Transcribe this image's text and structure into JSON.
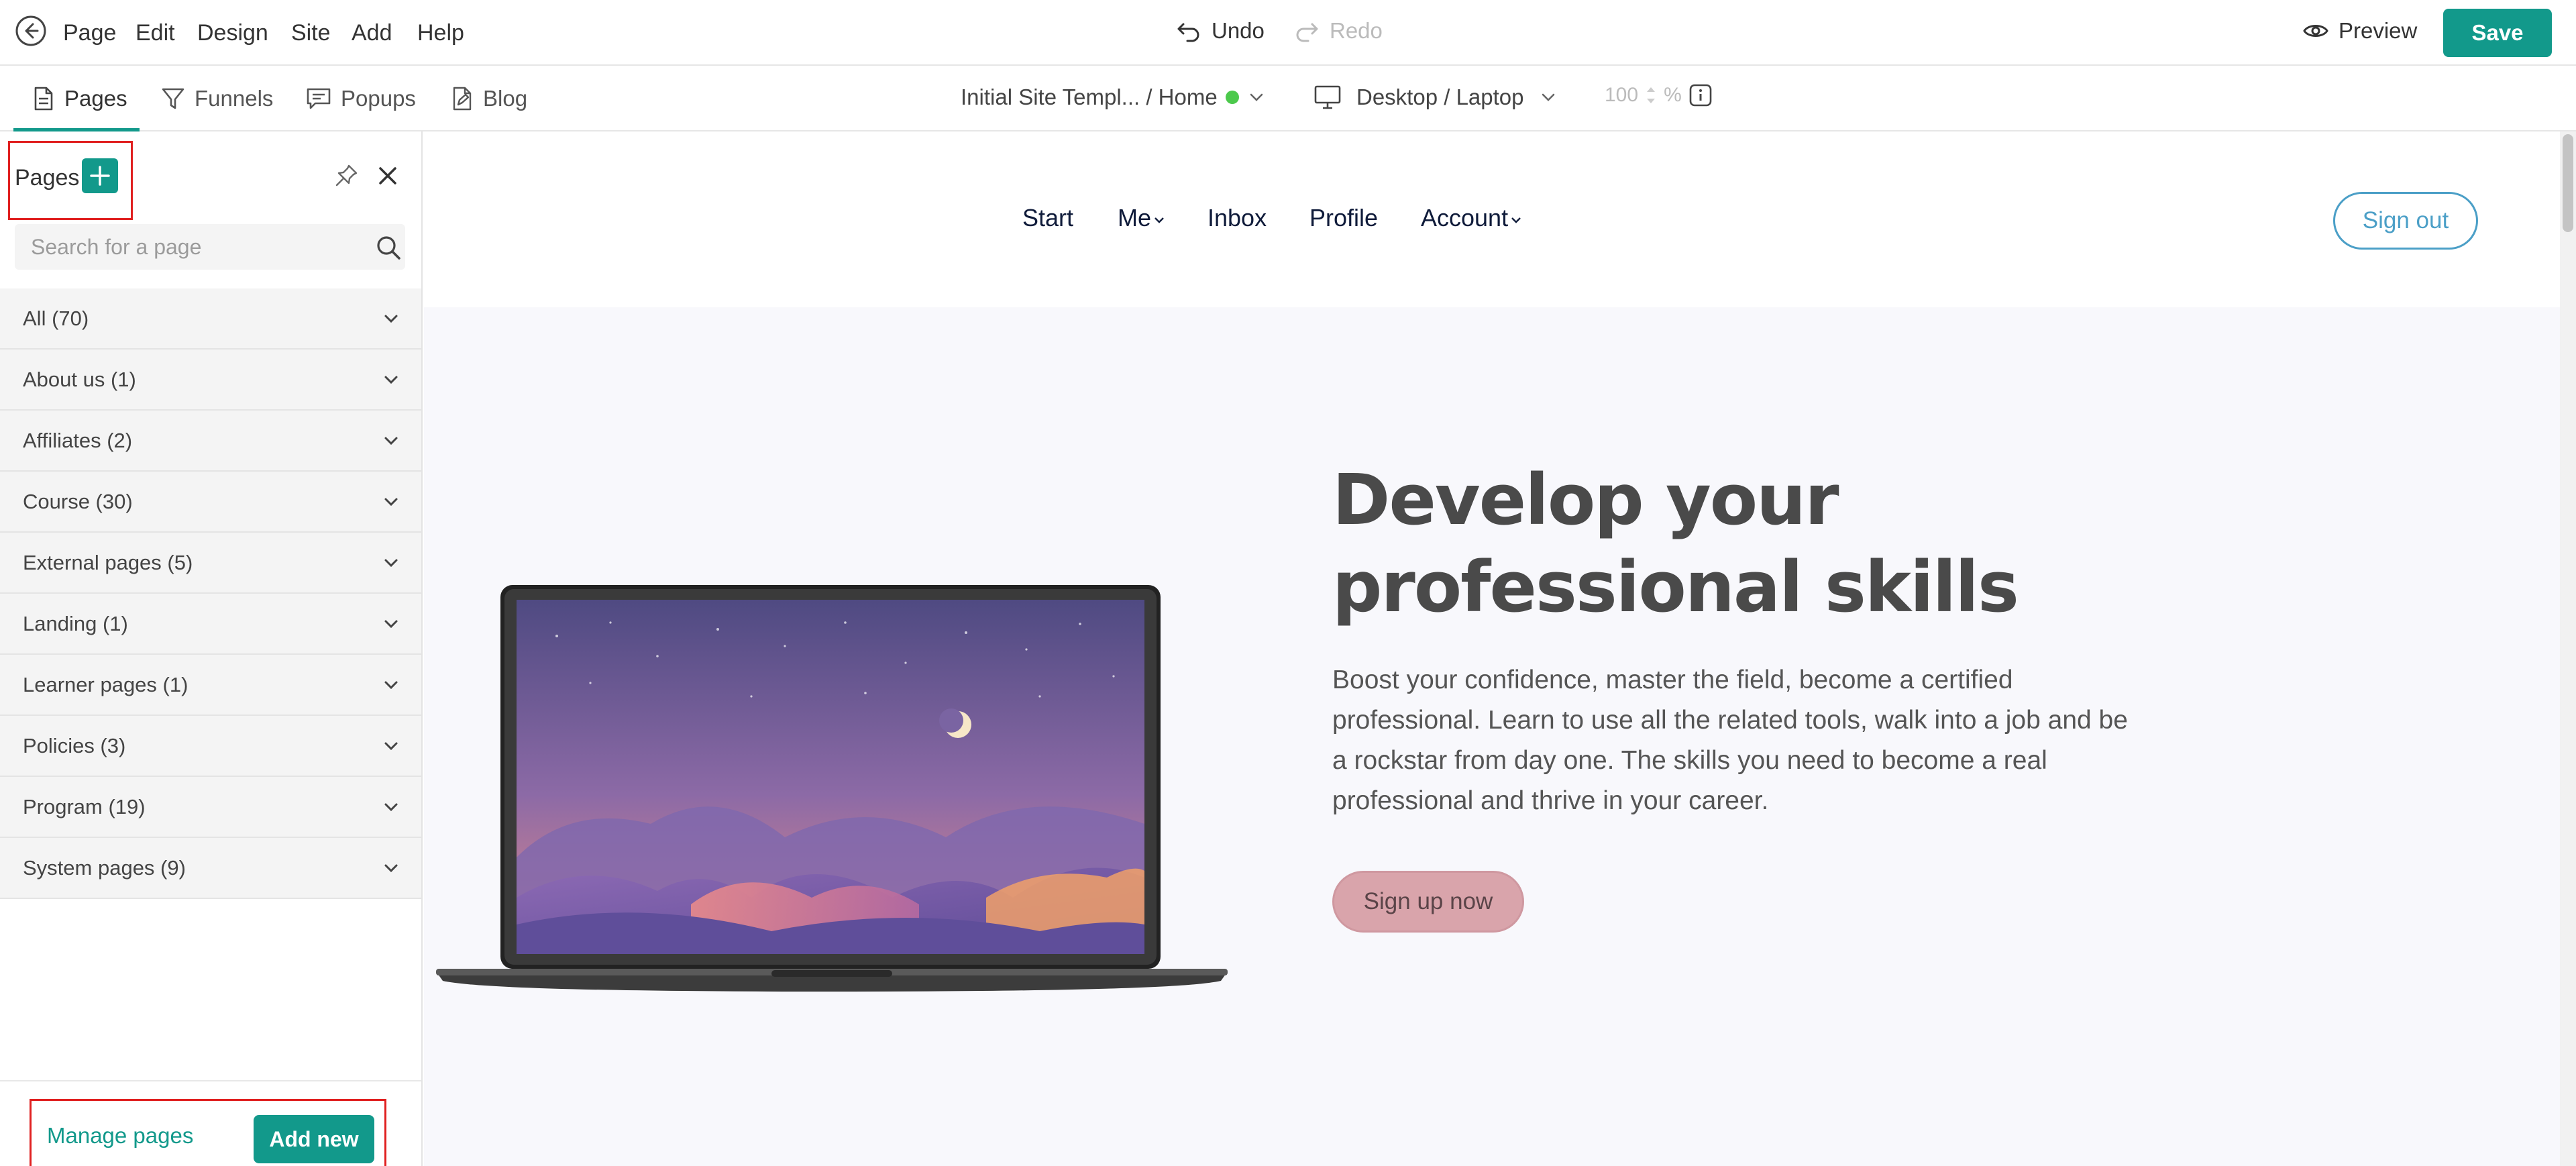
{
  "topbar": {
    "menu": [
      "Page",
      "Edit",
      "Design",
      "Site",
      "Add",
      "Help"
    ],
    "undo_label": "Undo",
    "redo_label": "Redo",
    "preview_label": "Preview",
    "save_label": "Save"
  },
  "secondbar": {
    "tabs": [
      {
        "label": "Pages",
        "icon": "page-icon",
        "active": true
      },
      {
        "label": "Funnels",
        "icon": "funnel-icon",
        "active": false
      },
      {
        "label": "Popups",
        "icon": "popup-icon",
        "active": false
      },
      {
        "label": "Blog",
        "icon": "blog-icon",
        "active": false
      }
    ],
    "breadcrumb": "Initial Site Templ... / Home",
    "device": "Desktop / Laptop",
    "zoom_value": "100",
    "zoom_unit": "%"
  },
  "sidebar": {
    "title": "Pages",
    "search_placeholder": "Search for a page",
    "categories": [
      "All (70)",
      "About us (1)",
      "Affiliates (2)",
      "Course (30)",
      "External pages (5)",
      "Landing (1)",
      "Learner pages (1)",
      "Policies (3)",
      "Program (19)",
      "System pages (9)"
    ],
    "manage_label": "Manage pages",
    "add_new_label": "Add new"
  },
  "site": {
    "nav": [
      "Start",
      "Me",
      "Inbox",
      "Profile",
      "Account"
    ],
    "signout_label": "Sign out",
    "hero_title": "Develop your professional skills",
    "hero_body": "Boost your confidence, master the field, become a certified professional. Learn to use all the related tools, walk into a job and be a rockstar from day one. The skills you need to become a real professional and thrive in your career.",
    "cta_label": "Sign up now"
  },
  "colors": {
    "accent": "#12998b",
    "highlight": "#e02020",
    "signout": "#4b9fc7",
    "cta": "#d9a4ab"
  }
}
